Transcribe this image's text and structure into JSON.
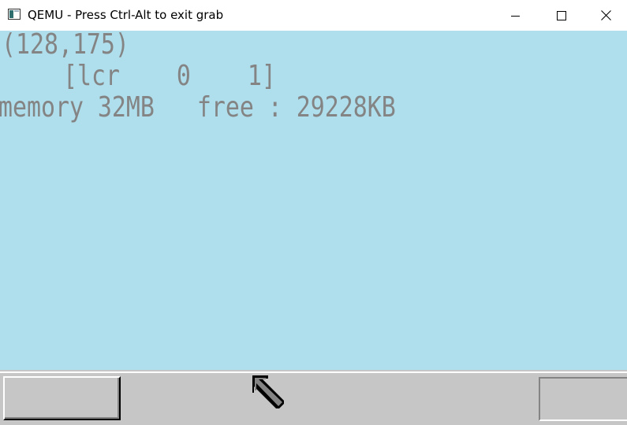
{
  "window": {
    "title": "QEMU - Press Ctrl-Alt to exit grab",
    "icon": "qemu-window-icon",
    "controls": {
      "minimize": "minimize-icon",
      "maximize": "maximize-icon",
      "close": "close-icon"
    }
  },
  "screen": {
    "background_color": "#afdeec",
    "text_color": "#848484",
    "lines": [
      "(128,175)",
      "[lcr    0    1]",
      "memory 32MB   free : 29228KB"
    ]
  },
  "taskbar": {
    "background_color": "#c6c6c6",
    "start_button_label": "",
    "tray_label": "",
    "cursor_icon": "mouse-cursor-icon"
  }
}
